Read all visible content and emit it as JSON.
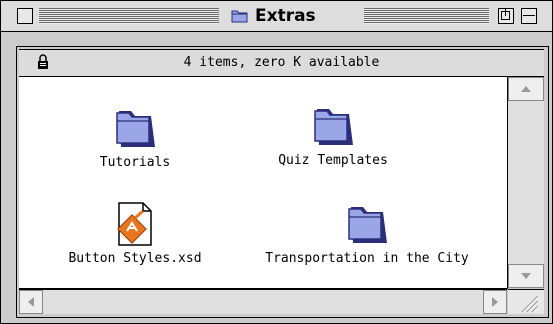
{
  "window": {
    "title": "Extras",
    "status": "4 items, zero K available"
  },
  "items": [
    {
      "label": "Tutorials",
      "icon": "folder-icon"
    },
    {
      "label": "Quiz Templates",
      "icon": "folder-icon"
    },
    {
      "label": "Button Styles.xsd",
      "icon": "document-icon"
    },
    {
      "label": "Transportation in the City",
      "icon": "folder-icon"
    }
  ],
  "colors": {
    "folder_fill": "#9aa6e6",
    "folder_outline": "#2b2f7a",
    "doc_accent": "#e8761f"
  }
}
